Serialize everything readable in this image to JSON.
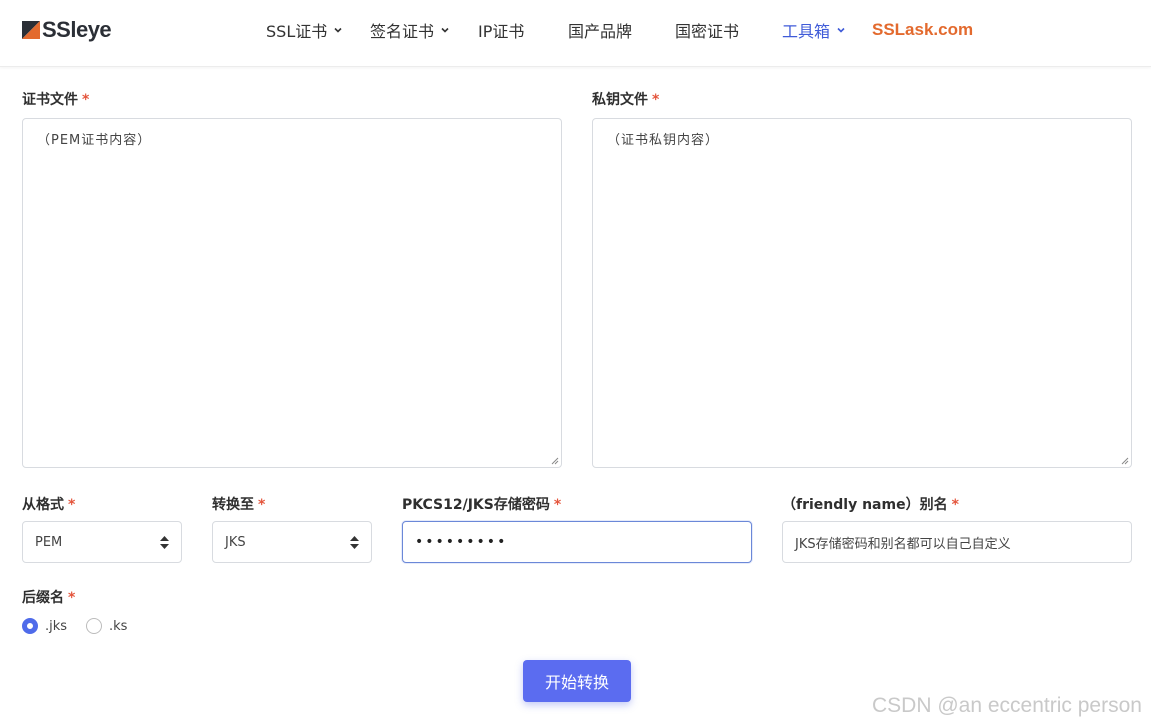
{
  "header": {
    "logo_text": "SSleye",
    "nav": [
      {
        "label": "SSL证书",
        "dropdown": true
      },
      {
        "label": "签名证书",
        "dropdown": true
      },
      {
        "label": "IP证书",
        "dropdown": false
      },
      {
        "label": "国产品牌",
        "dropdown": false
      },
      {
        "label": "国密证书",
        "dropdown": false
      },
      {
        "label": "工具箱",
        "dropdown": true,
        "active": true
      },
      {
        "label": "SSLask.com",
        "brand": true
      }
    ]
  },
  "form": {
    "required_mark": "*",
    "cert_file": {
      "label": "证书文件",
      "placeholder": "（PEM证书内容）"
    },
    "key_file": {
      "label": "私钥文件",
      "placeholder": "（证书私钥内容）"
    },
    "from_format": {
      "label": "从格式",
      "value": "PEM"
    },
    "convert_to": {
      "label": "转换至",
      "value": "JKS"
    },
    "store_password": {
      "label": "PKCS12/JKS存储密码",
      "value": "•••••••••"
    },
    "alias": {
      "label": "（friendly name）别名",
      "value": "JKS存储密码和别名都可以自己自定义"
    },
    "suffix": {
      "label": "后缀名",
      "options": [
        {
          "label": ".jks",
          "checked": true
        },
        {
          "label": ".ks",
          "checked": false
        }
      ]
    },
    "submit_label": "开始转换"
  },
  "watermark": "CSDN @an eccentric person",
  "colors": {
    "accent": "#5b6cf0",
    "nav_active": "#3f5bd8",
    "brand": "#e36a2e",
    "required": "#e4553c"
  }
}
